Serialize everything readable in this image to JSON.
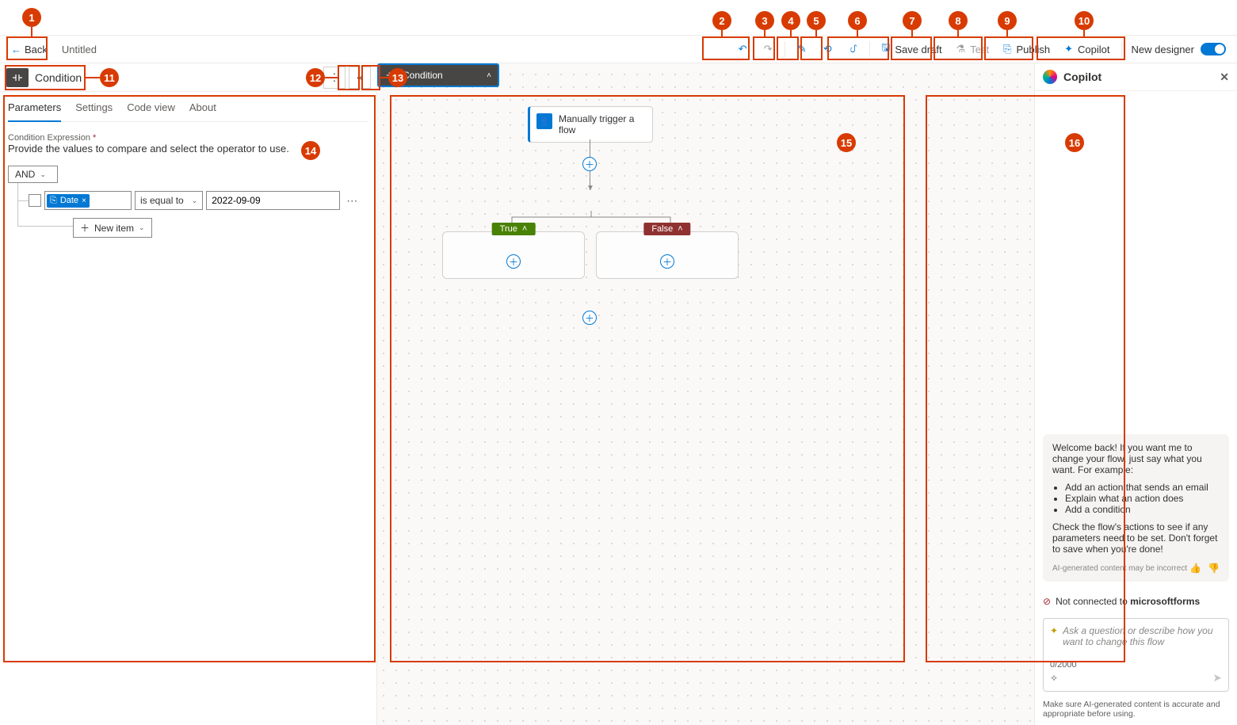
{
  "topbar": {
    "back": "Back",
    "title": "Untitled",
    "save_draft": "Save draft",
    "test": "Test",
    "publish": "Publish",
    "copilot": "Copilot",
    "new_designer": "New designer"
  },
  "panel": {
    "title": "Condition",
    "tabs": [
      "Parameters",
      "Settings",
      "Code view",
      "About"
    ],
    "active_tab": 0,
    "field_label": "Condition Expression",
    "field_help": "Provide the values to compare and select the operator to use.",
    "logic": "AND",
    "row": {
      "token": "Date",
      "operator": "is equal to",
      "value": "2022-09-09"
    },
    "new_item": "New item"
  },
  "canvas": {
    "trigger": "Manually trigger a flow",
    "condition": "Condition",
    "true": "True",
    "false": "False"
  },
  "copilot": {
    "title": "Copilot",
    "welcome": "Welcome back! If you want me to change your flow, just say what you want. For example:",
    "bullets": [
      "Add an action that sends an email",
      "Explain what an action does",
      "Add a condition"
    ],
    "hint": "Check the flow's actions to see if any parameters need to be set. Don't forget to save when you're done!",
    "disclaimer": "AI-generated content may be incorrect",
    "warn_pre": "Not connected to ",
    "warn_b": "microsoftforms",
    "placeholder": "Ask a question or describe how you want to change this flow",
    "count": "0/2000",
    "footer": "Make sure AI-generated content is accurate and appropriate before using."
  },
  "ann": [
    "1",
    "2",
    "3",
    "4",
    "5",
    "6",
    "7",
    "8",
    "9",
    "10",
    "11",
    "12",
    "13",
    "14",
    "15",
    "16"
  ]
}
